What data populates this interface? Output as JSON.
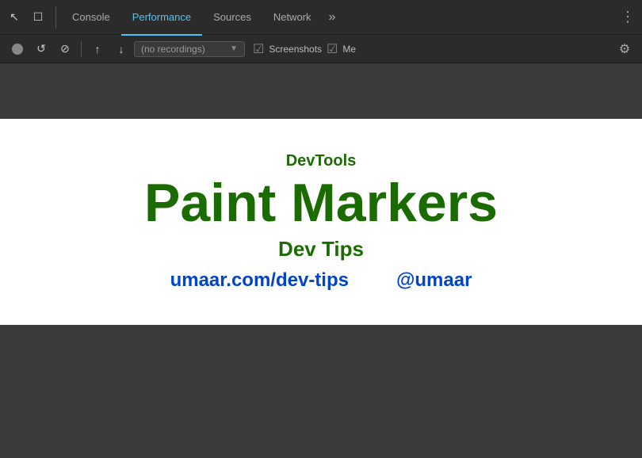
{
  "tabs": {
    "items": [
      {
        "label": "Console",
        "active": false
      },
      {
        "label": "Performance",
        "active": true
      },
      {
        "label": "Sources",
        "active": false
      },
      {
        "label": "Network",
        "active": false
      }
    ],
    "more_label": "»",
    "more_btn_label": "⋮"
  },
  "toolbar": {
    "no_recordings_placeholder": "(no recordings)",
    "screenshots_label": "Screenshots",
    "memory_label": "Me"
  },
  "content": {
    "devtools_label": "DevTools",
    "main_title": "Paint Markers",
    "subtitle": "Dev Tips",
    "link1": "umaar.com/dev-tips",
    "link2": "@umaar"
  },
  "icons": {
    "cursor": "↖",
    "box": "☐",
    "record": "●",
    "reload": "↺",
    "stop": "⊘",
    "upload": "↑",
    "download": "↓",
    "gear": "⚙",
    "screenshot_check": "☑"
  }
}
